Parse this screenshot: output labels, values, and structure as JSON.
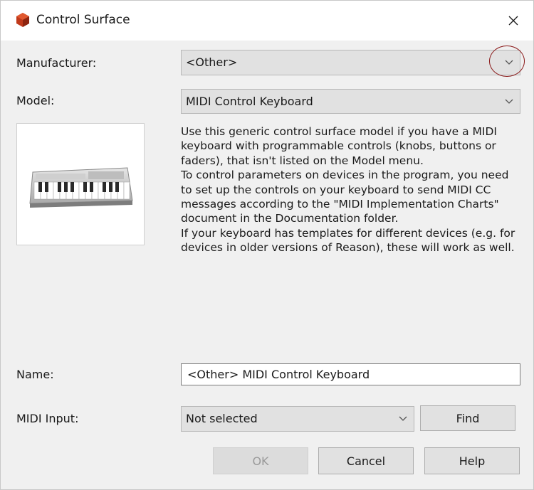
{
  "window": {
    "title": "Control Surface",
    "icon": "app-cube-icon",
    "close_icon": "close-icon"
  },
  "colors": {
    "app_icon": "#c0391b",
    "highlight_circle": "#8b1a1a"
  },
  "manufacturer": {
    "label": "Manufacturer:",
    "value": "<Other>"
  },
  "model": {
    "label": "Model:",
    "value": "MIDI Control Keyboard",
    "image_icon": "midi-keyboard-icon"
  },
  "description": {
    "p1": "Use this generic control surface model if you have a MIDI keyboard with programmable controls (knobs, buttons or faders), that isn't listed on the Model menu.",
    "p2": "To control parameters on devices in the program, you need to set up the controls on your keyboard to send MIDI CC messages according to the \"MIDI Implementation Charts\" document in the Documentation folder.",
    "p3": "If your keyboard has templates for different devices (e.g. for devices in older versions of Reason), these will work as well."
  },
  "name": {
    "label": "Name:",
    "value": "<Other> MIDI Control Keyboard"
  },
  "midi_input": {
    "label": "MIDI Input:",
    "value": "Not selected",
    "find_label": "Find"
  },
  "buttons": {
    "ok": "OK",
    "cancel": "Cancel",
    "help": "Help"
  }
}
